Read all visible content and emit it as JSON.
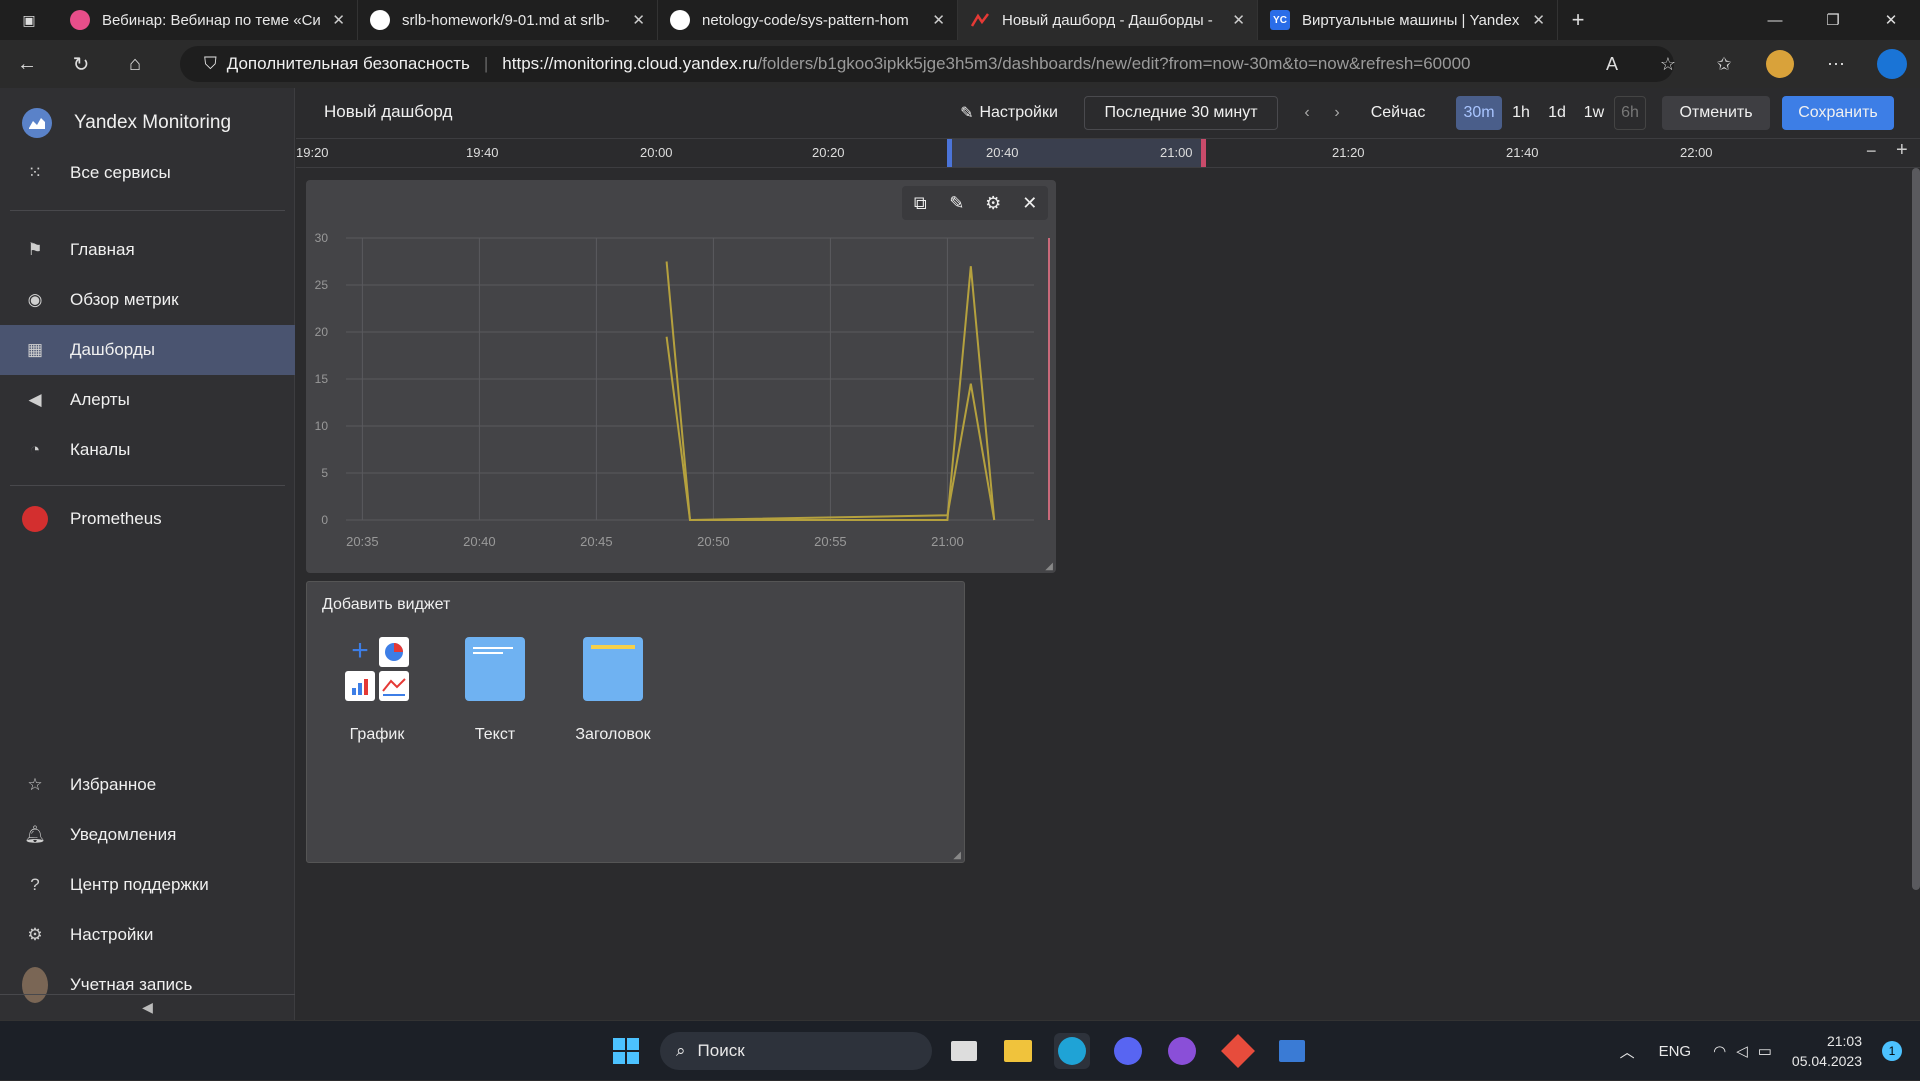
{
  "browser": {
    "tabs": [
      {
        "label": "Вебинар: Вебинар по теме «Си",
        "icon": "meeting-app-icon",
        "color": "#e84e8a"
      },
      {
        "label": "srlb-homework/9-01.md at srlb-",
        "icon": "github-icon",
        "color": "#ffffff"
      },
      {
        "label": "netology-code/sys-pattern-hom",
        "icon": "github-icon",
        "color": "#ffffff"
      },
      {
        "label": "Новый дашборд - Дашборды -",
        "icon": "monitoring-icon",
        "color": "#e53935"
      },
      {
        "label": "Виртуальные машины | Yandex",
        "icon": "yc-icon",
        "color": "#2a6de8",
        "icon_text": "YC"
      }
    ],
    "active_tab": 3,
    "address": {
      "security_label": "Дополнительная безопасность",
      "url_host": "https://monitoring.cloud.yandex.ru",
      "url_path": "/folders/b1gkoo3ipkk5jge3h5m3/dashboards/new/edit?from=now-30m&to=now&refresh=60000"
    }
  },
  "sidebar": {
    "brand": "Yandex Monitoring",
    "all_services": "Все сервисы",
    "nav": [
      {
        "label": "Главная",
        "icon": "flag-icon"
      },
      {
        "label": "Обзор метрик",
        "icon": "compass-icon"
      },
      {
        "label": "Дашборды",
        "icon": "dashboard-grid-icon",
        "active": true
      },
      {
        "label": "Алерты",
        "icon": "megaphone-icon"
      },
      {
        "label": "Каналы",
        "icon": "satellite-icon"
      }
    ],
    "prometheus": "Prometheus",
    "bottom": [
      {
        "label": "Избранное",
        "icon": "star-icon"
      },
      {
        "label": "Уведомления",
        "icon": "bell-icon"
      },
      {
        "label": "Центр поддержки",
        "icon": "help-icon"
      },
      {
        "label": "Настройки",
        "icon": "gear-icon"
      },
      {
        "label": "Учетная запись",
        "icon": "avatar"
      }
    ],
    "collapse": "◀"
  },
  "dashboard": {
    "title": "Новый дашборд",
    "settings_label": "Настройки",
    "time_range": "Последние 30 минут",
    "now_label": "Сейчас",
    "scales": [
      "30m",
      "1h",
      "1d",
      "1w",
      "6h"
    ],
    "active_scale": "30m",
    "cancel_label": "Отменить",
    "save_label": "Сохранить",
    "timeline_ticks": [
      "19:20",
      "19:40",
      "20:00",
      "20:20",
      "20:40",
      "21:00",
      "21:20",
      "21:40",
      "22:00"
    ],
    "zoom_out": "−",
    "zoom_in": "+"
  },
  "chart_data": {
    "type": "line",
    "x_ticks": [
      "20:35",
      "20:40",
      "20:45",
      "20:50",
      "20:55",
      "21:00"
    ],
    "y_ticks": [
      0,
      5,
      10,
      15,
      20,
      25,
      30
    ],
    "ylim": [
      0,
      30
    ],
    "grid": true,
    "line_color": "#b5a13e",
    "series": [
      {
        "x": [
          "20:48",
          "20:49",
          "21:00",
          "21:01",
          "21:02"
        ],
        "values": [
          27.5,
          0,
          0,
          27,
          0
        ]
      },
      {
        "x": [
          "20:48",
          "20:49",
          "21:00",
          "21:01",
          "21:02"
        ],
        "values": [
          19.5,
          0,
          0.5,
          14.5,
          0
        ]
      }
    ]
  },
  "add_widget": {
    "title": "Добавить виджет",
    "options": [
      {
        "label": "График",
        "icon": "chart-widget-icon"
      },
      {
        "label": "Текст",
        "icon": "text-widget-icon"
      },
      {
        "label": "Заголовок",
        "icon": "heading-widget-icon"
      }
    ]
  },
  "taskbar": {
    "search_label": "Поиск",
    "language": "ENG",
    "time": "21:03",
    "date": "05.04.2023",
    "notification_count": "1"
  }
}
